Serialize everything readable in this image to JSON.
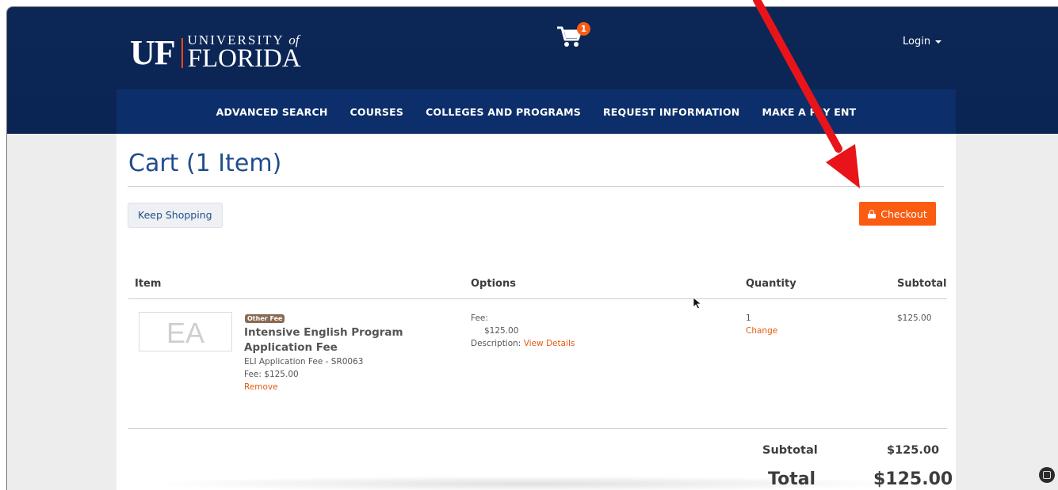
{
  "header": {
    "logo": {
      "mark": "UF",
      "university": "UNIVERSITY",
      "of": "of",
      "name": "FLORIDA"
    },
    "cart_count": "1",
    "login_label": "Login"
  },
  "nav": {
    "items": [
      "ADVANCED SEARCH",
      "COURSES",
      "COLLEGES AND PROGRAMS",
      "REQUEST INFORMATION",
      "MAKE A PAY ENT"
    ]
  },
  "cart": {
    "title": "Cart (1 Item)",
    "keep_shopping": "Keep Shopping",
    "checkout": "Checkout",
    "columns": {
      "item": "Item",
      "options": "Options",
      "quantity": "Quantity",
      "subtotal": "Subtotal"
    },
    "items": [
      {
        "thumb": "EA",
        "badge": "Other Fee",
        "name": "Intensive English Program Application Fee",
        "code_line": "ELI Application Fee - SR0063",
        "fee_line": "Fee: $125.00",
        "remove": "Remove",
        "options_fee_label": "Fee:",
        "options_fee_value": "$125.00",
        "options_desc_label": "Description:",
        "options_desc_link": "View Details",
        "quantity": "1",
        "change": "Change",
        "subtotal": "$125.00"
      }
    ],
    "summary": {
      "subtotal_label": "Subtotal",
      "subtotal_value": "$125.00",
      "total_label": "Total",
      "total_value": "$125.00"
    }
  },
  "colors": {
    "header_bg": "#0c2756",
    "nav_bg": "#0c2f6b",
    "accent_orange": "#fa5c12",
    "title_blue": "#1f4e8c",
    "annotation_arrow": "#e8141a"
  }
}
